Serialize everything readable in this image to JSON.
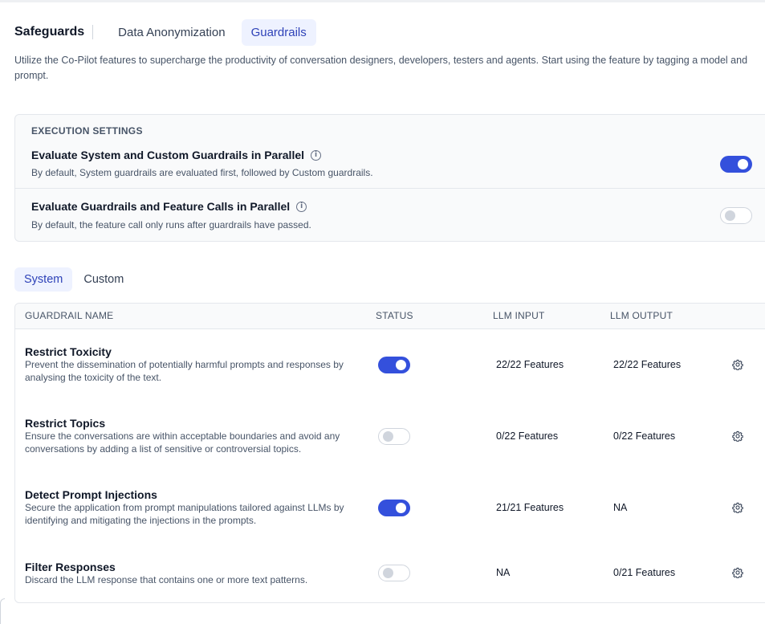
{
  "header": {
    "brand": "Safeguards",
    "tabs": [
      {
        "label": "Data Anonymization",
        "active": false
      },
      {
        "label": "Guardrails",
        "active": true
      }
    ]
  },
  "intro": "Utilize the Co-Pilot features to supercharge the productivity of conversation designers, developers, testers and agents. Start using the feature by tagging a model and prompt.",
  "execution_settings": {
    "title": "EXECUTION SETTINGS",
    "items": [
      {
        "title": "Evaluate System and Custom Guardrails in Parallel",
        "description": "By default, System guardrails are evaluated first, followed by Custom guardrails.",
        "enabled": true
      },
      {
        "title": "Evaluate Guardrails and Feature Calls in Parallel",
        "description": "By default, the feature call only runs after guardrails have passed.",
        "enabled": false
      }
    ]
  },
  "sub_tabs": [
    {
      "label": "System",
      "active": true
    },
    {
      "label": "Custom",
      "active": false
    }
  ],
  "table": {
    "columns": [
      "GUARDRAIL NAME",
      "STATUS",
      "LLM INPUT",
      "LLM OUTPUT"
    ],
    "rows": [
      {
        "name": "Restrict Toxicity",
        "description": "Prevent the dissemination of potentially harmful prompts and responses by analysing the toxicity of the text.",
        "enabled": true,
        "llm_input": "22/22 Features",
        "llm_output": "22/22 Features"
      },
      {
        "name": "Restrict Topics",
        "description": "Ensure the conversations are within acceptable boundaries and avoid any conversations by adding a list of sensitive or controversial topics.",
        "enabled": false,
        "llm_input": "0/22 Features",
        "llm_output": "0/22 Features"
      },
      {
        "name": "Detect Prompt Injections",
        "description": "Secure the application from prompt manipulations tailored against LLMs by identifying and mitigating the injections in the prompts.",
        "enabled": true,
        "llm_input": "21/21 Features",
        "llm_output": "NA"
      },
      {
        "name": "Filter Responses",
        "description": "Discard the LLM response that contains one or more text patterns.",
        "enabled": false,
        "llm_input": "NA",
        "llm_output": "0/21 Features"
      }
    ]
  },
  "icons": {
    "info": "info-circle-icon",
    "settings": "gear-icon"
  },
  "colors": {
    "accent": "#3450dc",
    "active_tab_bg": "#eef2ff",
    "active_tab_text": "#2e42b8"
  }
}
